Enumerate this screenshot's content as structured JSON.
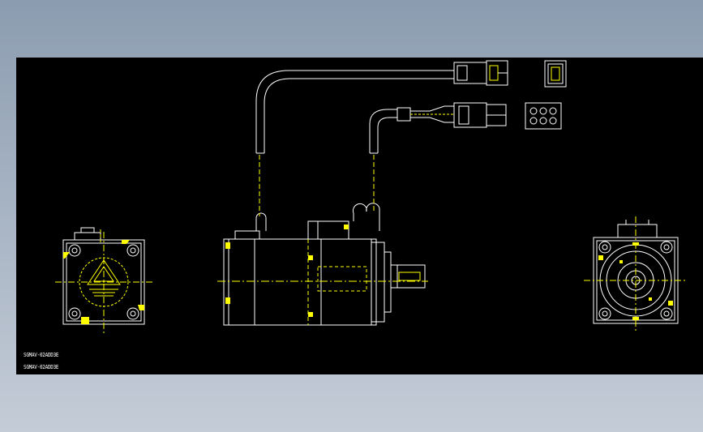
{
  "drawing": {
    "background": "#000000",
    "line_color": "#ffffff",
    "accent_color": "#ffff00",
    "model_labels": [
      "SGMAV-02ADD3E",
      "SGMAV-02ADD3E"
    ]
  }
}
